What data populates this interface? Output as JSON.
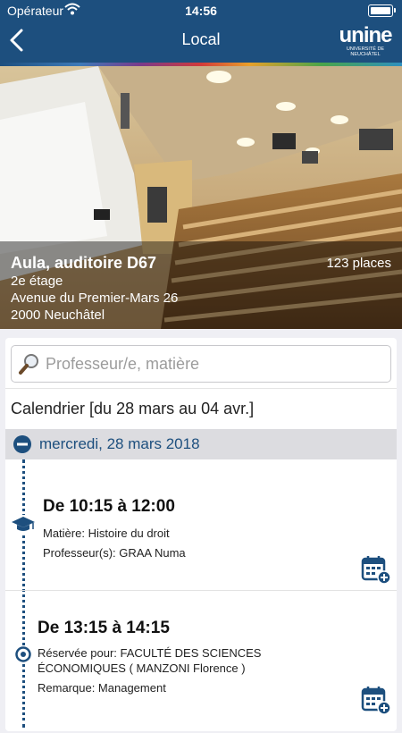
{
  "status_bar": {
    "carrier": "Opérateur",
    "time": "14:56"
  },
  "nav": {
    "title": "Local",
    "logo_word": "unine",
    "logo_sub1": "UNIVERSITÉ DE",
    "logo_sub2": "NEUCHÂTEL"
  },
  "room": {
    "name": "Aula, auditoire  D67",
    "capacity": "123 places",
    "floor": "2e étage",
    "street": "Avenue du Premier-Mars 26",
    "city": "2000 Neuchâtel"
  },
  "search": {
    "placeholder": "Professeur/e, matière",
    "value": ""
  },
  "calendar": {
    "heading": "Calendrier [du 28 mars au  04 avr.]",
    "day": "mercredi, 28 mars 2018",
    "events": [
      {
        "time": "De 10:15 à 12:00",
        "lines": [
          "Matière: Histoire du droit",
          "Professeur(s): GRAA Numa"
        ],
        "marker_icon": "graduation-cap-icon"
      },
      {
        "time": "De 13:15 à 14:15",
        "lines": [
          "Réservée pour: FACULTÉ DES SCIENCES",
          "ÉCONOMIQUES ( MANZONI Florence )",
          "Remarque: Management"
        ],
        "marker_icon": "target-icon"
      }
    ]
  },
  "colors": {
    "brand": "#1d4f7e",
    "background": "#efeff4",
    "day_row": "#dcdce0"
  }
}
